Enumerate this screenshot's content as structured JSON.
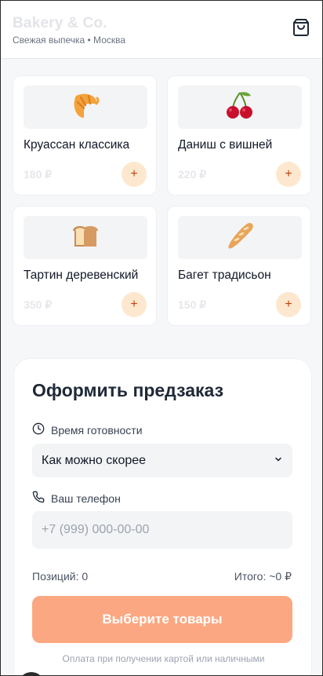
{
  "header": {
    "brand": "Bakery & Co.",
    "tagline": "Свежая выпечка • Москва",
    "cart_icon": "shopping-bag-icon"
  },
  "products": [
    {
      "name": "Круассан классика",
      "price": "180 ₽",
      "icon": "croissant-icon",
      "add_label": "+"
    },
    {
      "name": "Даниш с вишней",
      "price": "220 ₽",
      "icon": "cherry-icon",
      "add_label": "+"
    },
    {
      "name": "Тартин деревенский",
      "price": "350 ₽",
      "icon": "bread-icon",
      "add_label": "+"
    },
    {
      "name": "Багет традисьон",
      "price": "150 ₽",
      "icon": "baguette-icon",
      "add_label": "+"
    }
  ],
  "order": {
    "title": "Оформить предзаказ",
    "time_label": "Время готовности",
    "time_value": "Как можно скорее",
    "phone_label": "Ваш телефон",
    "phone_placeholder": "+7 (999) 000-00-00",
    "positions": "Позиций: 0",
    "total": "Итого: ~0 ₽",
    "submit_label": "Выберите товары",
    "note": "Оплата при получении картой или наличными"
  },
  "colors": {
    "accent": "#fba882",
    "add_button_bg": "#fde8cf",
    "add_button_fg": "#c2410c"
  }
}
